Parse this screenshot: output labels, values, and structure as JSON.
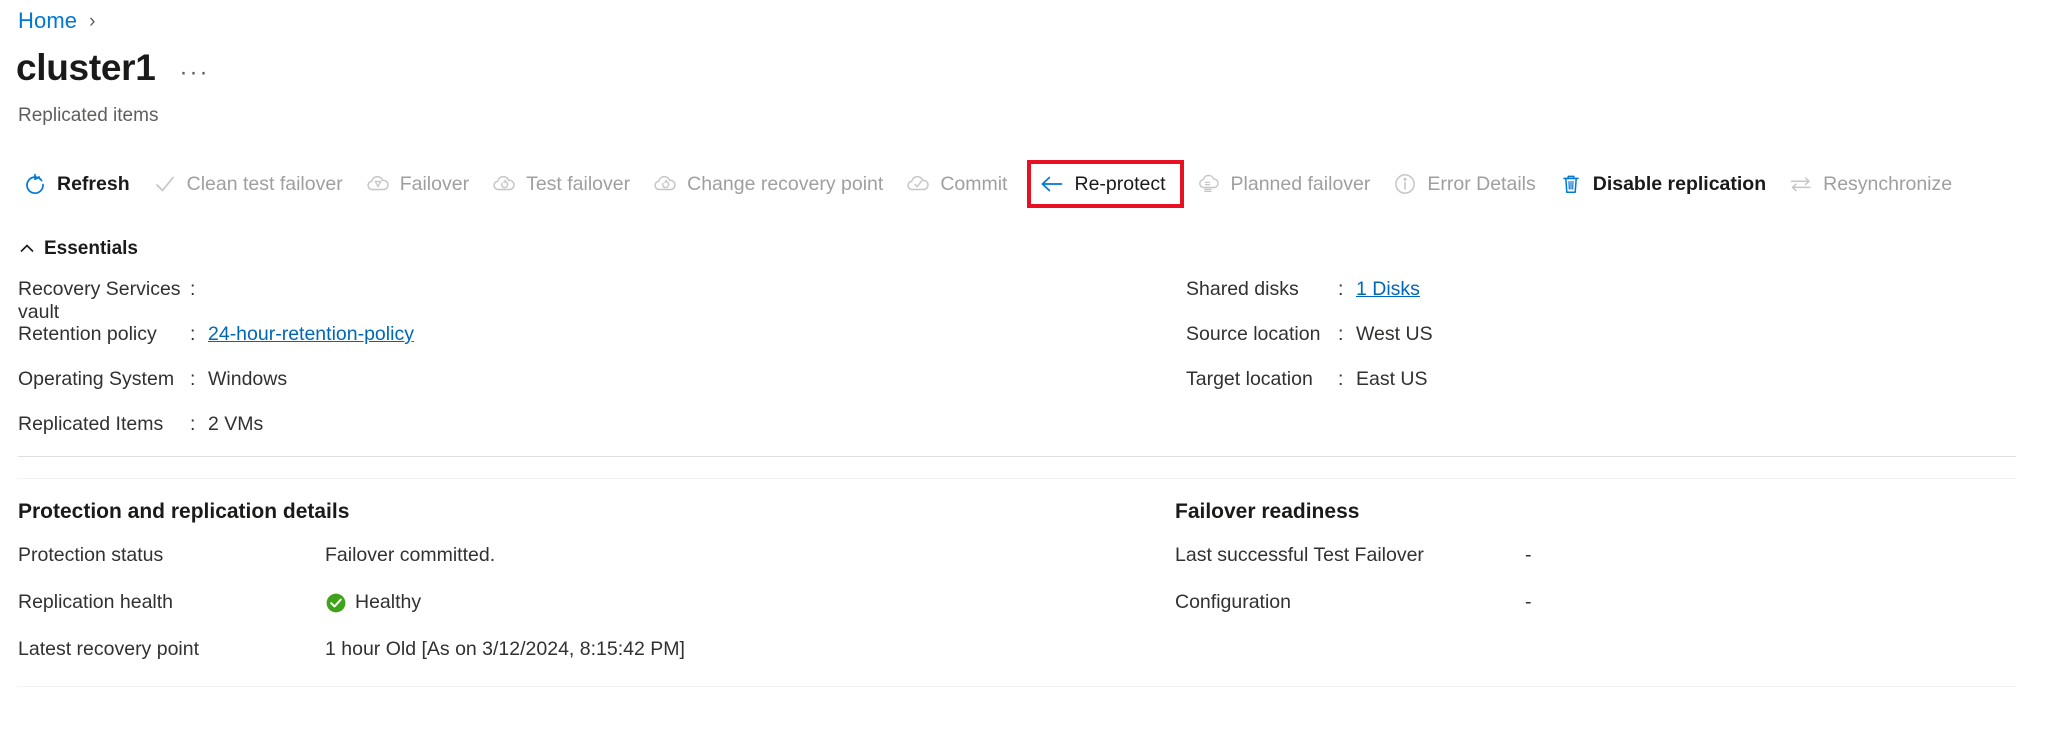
{
  "breadcrumb": {
    "home_label": "Home",
    "separator": "›"
  },
  "header": {
    "title": "cluster1",
    "ellipsis": "···",
    "subtitle": "Replicated items"
  },
  "commandbar": {
    "items": [
      {
        "label": "Refresh",
        "icon": "refresh-icon",
        "enabled": true,
        "highlighted": false
      },
      {
        "label": "Clean test failover",
        "icon": "checkmark-icon",
        "enabled": false,
        "highlighted": false
      },
      {
        "label": "Failover",
        "icon": "cloud-failover-icon",
        "enabled": false,
        "highlighted": false
      },
      {
        "label": "Test failover",
        "icon": "cloud-test-failover-icon",
        "enabled": false,
        "highlighted": false
      },
      {
        "label": "Change recovery point",
        "icon": "cloud-recovery-icon",
        "enabled": false,
        "highlighted": false
      },
      {
        "label": "Commit",
        "icon": "cloud-check-icon",
        "enabled": false,
        "highlighted": false
      },
      {
        "label": "Re-protect",
        "icon": "arrow-left-icon",
        "enabled": true,
        "highlighted": true
      },
      {
        "label": "Planned failover",
        "icon": "cloud-planned-icon",
        "enabled": false,
        "highlighted": false
      },
      {
        "label": "Error Details",
        "icon": "info-circle-icon",
        "enabled": false,
        "highlighted": false
      },
      {
        "label": "Disable replication",
        "icon": "trash-icon",
        "enabled": true,
        "highlighted": false
      },
      {
        "label": "Resynchronize",
        "icon": "resync-arrows-icon",
        "enabled": false,
        "highlighted": false
      }
    ]
  },
  "essentials": {
    "header_label": "Essentials",
    "left_rows": [
      {
        "key": "Recovery Services vault",
        "sep": ":",
        "value": "",
        "link": false
      },
      {
        "key": "Retention policy",
        "sep": ":",
        "value": "24-hour-retention-policy",
        "link": true
      },
      {
        "key": "Operating System",
        "sep": ":",
        "value": "Windows",
        "link": false
      },
      {
        "key": "Replicated Items",
        "sep": ":",
        "value": "2 VMs",
        "link": false
      }
    ],
    "right_rows": [
      {
        "key": "Shared disks",
        "sep": ":",
        "value": "1 Disks",
        "link": true
      },
      {
        "key": "Source location",
        "sep": ":",
        "value": "West US",
        "link": false
      },
      {
        "key": "Target location",
        "sep": ":",
        "value": "East US",
        "link": false
      }
    ]
  },
  "protection": {
    "title": "Protection and replication details",
    "rows": [
      {
        "key": "Protection status",
        "value": "Failover committed.",
        "status_icon": ""
      },
      {
        "key": "Replication health",
        "value": "Healthy",
        "status_icon": "health-check-icon"
      },
      {
        "key": "Latest recovery point",
        "value": "1 hour Old [As on 3/12/2024, 8:15:42 PM]",
        "status_icon": ""
      }
    ]
  },
  "failover_readiness": {
    "title": "Failover readiness",
    "rows": [
      {
        "key": "Last successful Test Failover",
        "value": "-"
      },
      {
        "key": "Configuration",
        "value": "-"
      }
    ]
  },
  "colors": {
    "accent": "#0078d4",
    "link": "#0067b8",
    "highlight_box": "#e81123",
    "healthy_green": "#3FA21B",
    "disabled_text": "#a19f9d"
  }
}
